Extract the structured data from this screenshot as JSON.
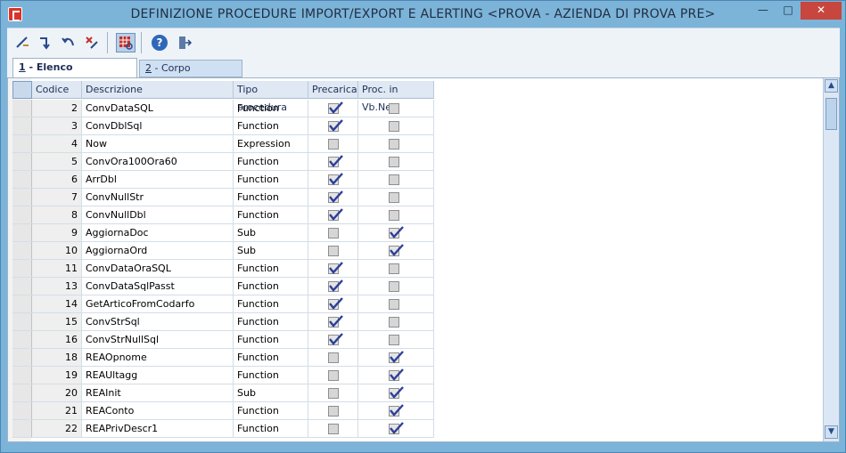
{
  "window": {
    "title": "DEFINIZIONE PROCEDURE IMPORT/EXPORT E ALERTING <PROVA - AZIENDA DI PROVA PRE>",
    "minimize_icon": "minimize-icon",
    "maximize_icon": "maximize-icon",
    "close_icon": "close-icon"
  },
  "toolbar": {
    "buttons": [
      {
        "icon": "new-record-icon"
      },
      {
        "icon": "save-record-icon"
      },
      {
        "icon": "undo-record-icon"
      },
      {
        "icon": "delete-record-icon"
      },
      {
        "icon": "grid-view-icon"
      },
      {
        "icon": "help-icon",
        "label": "?"
      },
      {
        "icon": "exit-icon"
      }
    ]
  },
  "tabs": [
    {
      "num": "1",
      "label": " - Elenco Procedure"
    },
    {
      "num": "2",
      "label": " - Corpo Procedura"
    }
  ],
  "grid": {
    "columns": [
      "Codice",
      "Descrizione",
      "Tipo procedura",
      "Precarica",
      "Proc. in Vb.Net"
    ],
    "rows": [
      {
        "codice": "2",
        "descrizione": "ConvDataSQL",
        "tipo": "Function",
        "precarica": true,
        "vbnet": false
      },
      {
        "codice": "3",
        "descrizione": "ConvDblSql",
        "tipo": "Function",
        "precarica": true,
        "vbnet": false
      },
      {
        "codice": "4",
        "descrizione": "Now",
        "tipo": "Expression",
        "precarica": false,
        "vbnet": false
      },
      {
        "codice": "5",
        "descrizione": "ConvOra100Ora60",
        "tipo": "Function",
        "precarica": true,
        "vbnet": false
      },
      {
        "codice": "6",
        "descrizione": "ArrDbl",
        "tipo": "Function",
        "precarica": true,
        "vbnet": false
      },
      {
        "codice": "7",
        "descrizione": "ConvNullStr",
        "tipo": "Function",
        "precarica": true,
        "vbnet": false
      },
      {
        "codice": "8",
        "descrizione": "ConvNullDbl",
        "tipo": "Function",
        "precarica": true,
        "vbnet": false
      },
      {
        "codice": "9",
        "descrizione": "AggiornaDoc",
        "tipo": "Sub",
        "precarica": false,
        "vbnet": true
      },
      {
        "codice": "10",
        "descrizione": "AggiornaOrd",
        "tipo": "Sub",
        "precarica": false,
        "vbnet": true
      },
      {
        "codice": "11",
        "descrizione": "ConvDataOraSQL",
        "tipo": "Function",
        "precarica": true,
        "vbnet": false
      },
      {
        "codice": "13",
        "descrizione": "ConvDataSqlPasst",
        "tipo": "Function",
        "precarica": true,
        "vbnet": false
      },
      {
        "codice": "14",
        "descrizione": "GetArticoFromCodarfo",
        "tipo": "Function",
        "precarica": true,
        "vbnet": false
      },
      {
        "codice": "15",
        "descrizione": "ConvStrSql",
        "tipo": "Function",
        "precarica": true,
        "vbnet": false
      },
      {
        "codice": "16",
        "descrizione": "ConvStrNullSql",
        "tipo": "Function",
        "precarica": true,
        "vbnet": false
      },
      {
        "codice": "18",
        "descrizione": "REAOpnome",
        "tipo": "Function",
        "precarica": false,
        "vbnet": true
      },
      {
        "codice": "19",
        "descrizione": "REAUltagg",
        "tipo": "Function",
        "precarica": false,
        "vbnet": true
      },
      {
        "codice": "20",
        "descrizione": "REAInit",
        "tipo": "Sub",
        "precarica": false,
        "vbnet": true
      },
      {
        "codice": "21",
        "descrizione": "REAConto",
        "tipo": "Function",
        "precarica": false,
        "vbnet": true
      },
      {
        "codice": "22",
        "descrizione": "REAPrivDescr1",
        "tipo": "Function",
        "precarica": false,
        "vbnet": true
      }
    ]
  },
  "leftbar": {
    "icons": [
      "copy-icon",
      "list-icon",
      "import-icon",
      "zoom-icon",
      "detail-icon",
      "filter-add-icon",
      "filter-icon",
      "anchor-icon",
      "export-x-icon",
      "export-h-icon",
      "export-c-icon",
      "monitor-icon",
      "print-icon"
    ]
  },
  "colors": {
    "titlebar": "#7cb3d9",
    "close_button": "#c7463d",
    "check": "#2d3f99"
  }
}
